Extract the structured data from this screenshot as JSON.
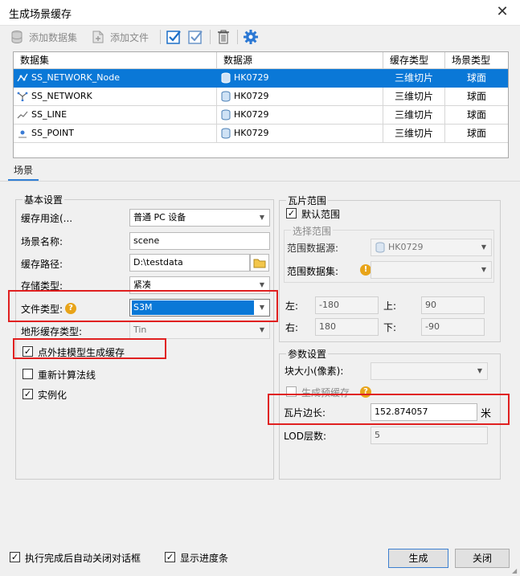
{
  "window": {
    "title": "生成场景缓存",
    "close": "✕"
  },
  "toolbar": {
    "add_dataset": "添加数据集",
    "add_file": "添加文件"
  },
  "grid": {
    "headers": [
      "数据集",
      "数据源",
      "缓存类型",
      "场景类型"
    ],
    "rows": [
      {
        "dataset": "SS_NETWORK_Node",
        "datasource": "HK0729",
        "cache_type": "三维切片",
        "scene_type": "球面"
      },
      {
        "dataset": "SS_NETWORK",
        "datasource": "HK0729",
        "cache_type": "三维切片",
        "scene_type": "球面"
      },
      {
        "dataset": "SS_LINE",
        "datasource": "HK0729",
        "cache_type": "三维切片",
        "scene_type": "球面"
      },
      {
        "dataset": "SS_POINT",
        "datasource": "HK0729",
        "cache_type": "三维切片",
        "scene_type": "球面"
      }
    ]
  },
  "tab": {
    "label": "场景"
  },
  "basic": {
    "title": "基本设置",
    "cache_usage_label": "缓存用途(...",
    "cache_usage_value": "普通 PC 设备",
    "scene_name_label": "场景名称:",
    "scene_name_value": "scene",
    "cache_path_label": "缓存路径:",
    "cache_path_value": "D:\\testdata",
    "storage_type_label": "存储类型:",
    "storage_type_value": "紧凑",
    "file_type_label": "文件类型:",
    "file_type_value": "S3M",
    "terrain_label": "地形缓存类型:",
    "terrain_value": "Tin",
    "cb_external_model": "点外挂模型生成缓存",
    "cb_recompute_normals": "重新计算法线",
    "cb_instancing": "实例化"
  },
  "tile_range": {
    "title": "瓦片范围",
    "cb_default": "默认范围",
    "select_range": "选择范围",
    "range_datasource_label": "范围数据源:",
    "range_datasource_value": "HK0729",
    "range_dataset_label": "范围数据集:",
    "left_label": "左:",
    "left_value": "-180",
    "top_label": "上:",
    "top_value": "90",
    "right_label": "右:",
    "right_value": "180",
    "bottom_label": "下:",
    "bottom_value": "-90"
  },
  "params": {
    "title": "参数设置",
    "block_size_label": "块大小(像素):",
    "gen_precache": "生成预缓存",
    "tile_side_label": "瓦片边长:",
    "tile_side_value": "152.874057",
    "tile_side_unit": "米",
    "lod_label": "LOD层数:",
    "lod_value": "5"
  },
  "footer": {
    "cb_auto_close": "执行完成后自动关闭对话框",
    "cb_show_progress": "显示进度条",
    "generate": "生成",
    "close": "关闭"
  },
  "colors": {
    "selection": "#0a78d7",
    "highlight_box": "#e02020",
    "checkbox_blue": "#1c6fc8",
    "gear_blue": "#2b78d4"
  }
}
